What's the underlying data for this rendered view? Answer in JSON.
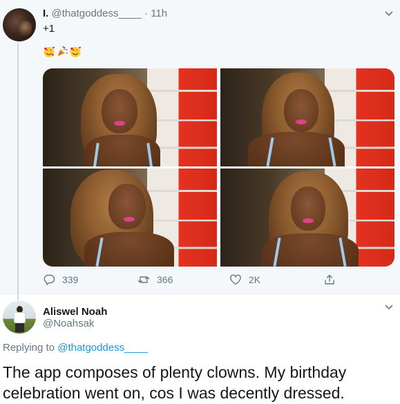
{
  "tweet_top": {
    "author_name": "I.",
    "handle": "@thatgoddess____",
    "separator": "·",
    "time": "11h",
    "text": "+1",
    "emojis": [
      "smiling-face-with-hearts-emoji",
      "party-popper-emoji",
      "smiling-face-with-hearts-emoji"
    ],
    "media": {
      "photo_count": 4,
      "icons": [
        "photo-1",
        "photo-2",
        "photo-3",
        "photo-4"
      ]
    },
    "actions": {
      "replies": "339",
      "retweets": "366",
      "likes": "2K"
    },
    "icons": {
      "reply": "reply-icon",
      "retweet": "retweet-icon",
      "like": "heart-icon",
      "share": "share-icon",
      "more": "chevron-down-icon"
    }
  },
  "tweet_main": {
    "author_name": "Aliswel Noah",
    "handle": "@Noahsak",
    "replying_prefix": "Replying to",
    "replying_handle": "@thatgoddess____",
    "text": "The app composes of plenty clowns. My birthday celebration went on, cos I was decently dressed."
  },
  "colors": {
    "link": "#1b95e0",
    "secondary_text": "#657786",
    "primary_text": "#14171a",
    "highlight_background": "#f5f8fa",
    "thread_line": "#ccd6dd"
  }
}
